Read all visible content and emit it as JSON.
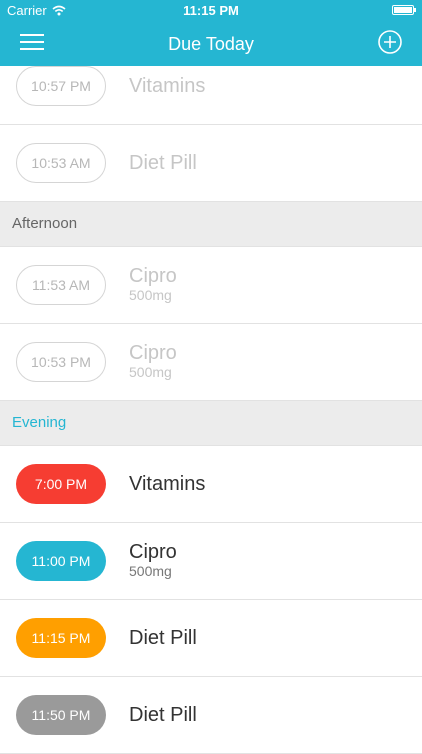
{
  "status_bar": {
    "carrier": "Carrier",
    "time": "11:15 PM"
  },
  "nav": {
    "title": "Due Today",
    "menu_icon": "hamburger-menu-icon",
    "add_icon": "plus-circle-icon"
  },
  "colors": {
    "accent": "#25b6d2",
    "red": "#f63d32",
    "orange": "#ff9f00",
    "gray": "#9a9a9a"
  },
  "sections": {
    "morning_items": [
      {
        "time": "10:57 PM",
        "name": "Vitamins"
      },
      {
        "time": "10:53 AM",
        "name": "Diet Pill"
      }
    ],
    "afternoon": {
      "label": "Afternoon",
      "items": [
        {
          "time": "11:53 AM",
          "name": "Cipro",
          "dose": "500mg"
        },
        {
          "time": "10:53 PM",
          "name": "Cipro",
          "dose": "500mg"
        }
      ]
    },
    "evening": {
      "label": "Evening",
      "items": [
        {
          "time": "7:00 PM",
          "name": "Vitamins",
          "color": "#f63d32"
        },
        {
          "time": "11:00 PM",
          "name": "Cipro",
          "dose": "500mg",
          "color": "#25b6d2"
        },
        {
          "time": "11:15 PM",
          "name": "Diet Pill",
          "color": "#ff9f00"
        },
        {
          "time": "11:50 PM",
          "name": "Diet Pill",
          "color": "#9a9a9a"
        }
      ]
    }
  }
}
